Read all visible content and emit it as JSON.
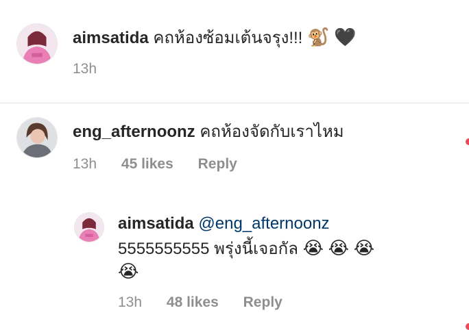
{
  "comments": [
    {
      "username": "aimsatida",
      "text": "คถห้องซ้อมเต้นจรุง!!!",
      "emojis": [
        "🐒",
        "🖤"
      ],
      "time": "13h",
      "likes": "",
      "reply": ""
    },
    {
      "username": "eng_afternoonz",
      "text": "คถห้องจัดกับเราไหม",
      "time": "13h",
      "likes": "45 likes",
      "reply": "Reply"
    }
  ],
  "reply": {
    "username": "aimsatida",
    "mention": "@eng_afternoonz",
    "text": "5555555555 พรุ่งนี้เจอกัล",
    "emojis_line1": [
      "😭",
      "😭",
      "😭"
    ],
    "emojis_line2": [
      "😭"
    ],
    "time": "13h",
    "likes": "48 likes",
    "reply": "Reply"
  },
  "icons": {
    "avatar_a": "avatar-pink-hoodie",
    "avatar_b": "avatar-woman-grey",
    "heart_accent": "#ed4956"
  }
}
